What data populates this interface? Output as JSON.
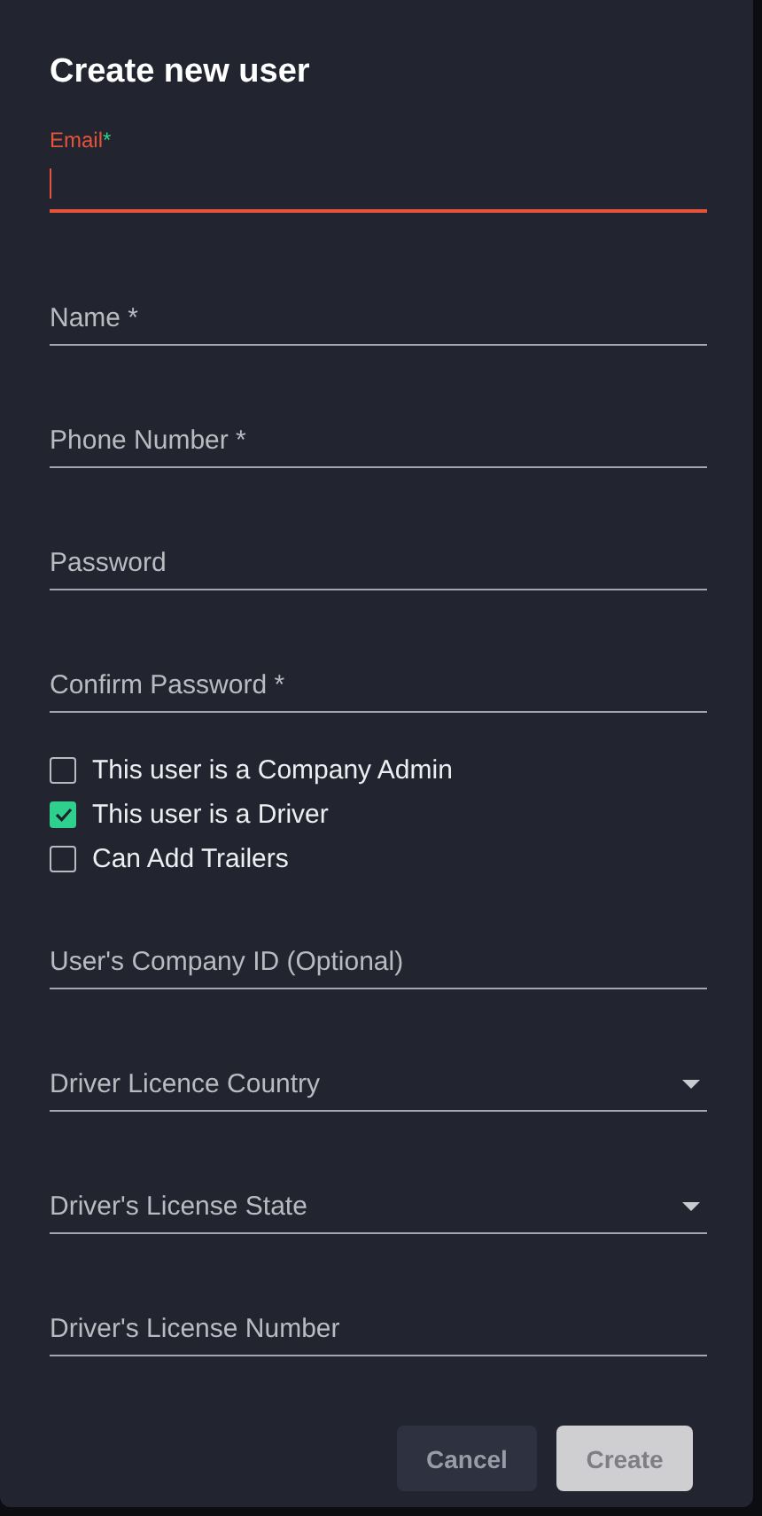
{
  "dialog": {
    "title": "Create new user"
  },
  "fields_top": [
    {
      "kind": "text",
      "label": "Email",
      "required_mark": "*",
      "focused": true
    },
    {
      "kind": "text",
      "placeholder": "Name *",
      "focused": false
    },
    {
      "kind": "text",
      "placeholder": "Phone Number *",
      "focused": false
    },
    {
      "kind": "text",
      "placeholder": "Password",
      "focused": false
    },
    {
      "kind": "text",
      "placeholder": "Confirm Password *",
      "focused": false
    }
  ],
  "checkboxes": [
    {
      "label": "This user is a Company Admin",
      "checked": false
    },
    {
      "label": "This user is a Driver",
      "checked": true
    },
    {
      "label": "Can Add Trailers",
      "checked": false
    }
  ],
  "fields_bottom": [
    {
      "kind": "text",
      "placeholder": "User's Company ID (Optional)",
      "focused": false
    },
    {
      "kind": "select",
      "placeholder": "Driver Licence Country",
      "focused": false
    },
    {
      "kind": "select",
      "placeholder": "Driver's License State",
      "focused": false
    },
    {
      "kind": "text",
      "placeholder": "Driver's License Number",
      "focused": false
    }
  ],
  "buttons": [
    {
      "kind": "secondary",
      "label": "Cancel"
    },
    {
      "kind": "primary",
      "label": "Create"
    }
  ]
}
